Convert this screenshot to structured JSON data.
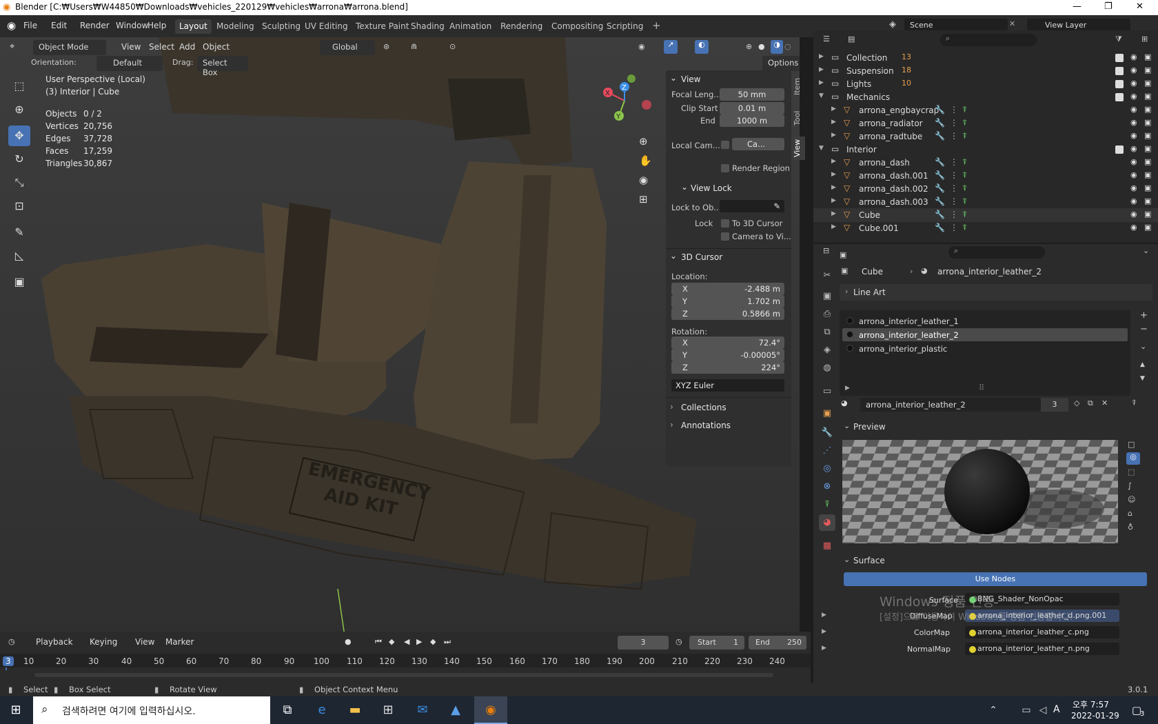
{
  "titlebar": {
    "title": "Blender [C:₩Users₩W44850₩Downloads₩vehicles_220129₩vehicles₩arrona₩arrona.blend]",
    "minimize": "—",
    "maximize": "❐",
    "close": "✕"
  },
  "menus": [
    "File",
    "Edit",
    "Render",
    "Window",
    "Help"
  ],
  "workspaces": [
    "Layout",
    "Modeling",
    "Sculpting",
    "UV Editing",
    "Texture Paint",
    "Shading",
    "Animation",
    "Rendering",
    "Compositing",
    "Scripting"
  ],
  "active_workspace": "Layout",
  "scene": {
    "label": "Scene",
    "view_layer": "View Layer"
  },
  "viewport_header": {
    "mode": "Object Mode",
    "menus": [
      "View",
      "Select",
      "Add",
      "Object"
    ],
    "transform": "Global",
    "options": "Options"
  },
  "tool_settings": {
    "orientation_label": "Orientation:",
    "orientation_value": "Default",
    "drag_label": "Drag:",
    "drag_value": "Select Box"
  },
  "viewport_info": {
    "view_name": "User Perspective (Local)",
    "context": "(3) Interior | Cube"
  },
  "stats": [
    {
      "label": "Objects",
      "value": "0 / 2"
    },
    {
      "label": "Vertices",
      "value": "20,756"
    },
    {
      "label": "Edges",
      "value": "37,728"
    },
    {
      "label": "Faces",
      "value": "17,259"
    },
    {
      "label": "Triangles",
      "value": "30,867"
    }
  ],
  "scene_label": {
    "line1": "EMERGENCY",
    "line2": "AID KIT"
  },
  "npanel": {
    "view_title": "View",
    "focal_label": "Focal Leng...",
    "focal_value": "50 mm",
    "clip_start_label": "Clip Start",
    "clip_start_value": "0.01 m",
    "clip_end_label": "End",
    "clip_end_value": "1000 m",
    "local_cam_label": "Local Cam...",
    "local_cam_value": "Ca...",
    "render_region": "Render Region",
    "view_lock_title": "View Lock",
    "lock_to_obj_label": "Lock to Ob...",
    "lock_label": "Lock",
    "to_3d_cursor": "To 3D Cursor",
    "camera_to_view": "Camera to Vi...",
    "cursor_title": "3D Cursor",
    "location_label": "Location:",
    "loc": [
      {
        "axis": "X",
        "value": "-2.488 m"
      },
      {
        "axis": "Y",
        "value": "1.702 m"
      },
      {
        "axis": "Z",
        "value": "0.5866 m"
      }
    ],
    "rotation_label": "Rotation:",
    "rot": [
      {
        "axis": "X",
        "value": "72.4°"
      },
      {
        "axis": "Y",
        "value": "-0.00005°"
      },
      {
        "axis": "Z",
        "value": "224°"
      }
    ],
    "rotation_mode": "XYZ Euler",
    "collections": "Collections",
    "annotations": "Annotations",
    "tabs": [
      "Item",
      "Tool",
      "View"
    ]
  },
  "outliner": [
    {
      "name": "Collection",
      "type": "collection",
      "badge": "13"
    },
    {
      "name": "Suspension",
      "type": "collection",
      "badge": "18"
    },
    {
      "name": "Lights",
      "type": "collection",
      "badge": "10"
    },
    {
      "name": "Mechanics",
      "type": "collection",
      "badge": ""
    },
    {
      "name": "arrona_engbaycrap",
      "type": "object",
      "badge": ""
    },
    {
      "name": "arrona_radiator",
      "type": "object",
      "badge": ""
    },
    {
      "name": "arrona_radtube",
      "type": "object",
      "badge": ""
    },
    {
      "name": "Interior",
      "type": "collection",
      "badge": ""
    },
    {
      "name": "arrona_dash",
      "type": "object",
      "badge": ""
    },
    {
      "name": "arrona_dash.001",
      "type": "object",
      "badge": ""
    },
    {
      "name": "arrona_dash.002",
      "type": "object",
      "badge": ""
    },
    {
      "name": "arrona_dash.003",
      "type": "object",
      "badge": ""
    },
    {
      "name": "Cube",
      "type": "object",
      "badge": ""
    },
    {
      "name": "Cube.001",
      "type": "object",
      "badge": ""
    }
  ],
  "properties": {
    "breadcrumb_obj": "Cube",
    "breadcrumb_mat": "arrona_interior_leather_2",
    "line_art": "Line Art",
    "slots": [
      "arrona_interior_leather_1",
      "arrona_interior_leather_2",
      "arrona_interior_plastic"
    ],
    "selected_slot": 1,
    "material_name": "arrona_interior_leather_2",
    "user_count": "3",
    "preview": "Preview",
    "surface_title": "Surface",
    "use_nodes": "Use Nodes",
    "surface_label": "Surface",
    "surface_value": "BNG_Shader_NonOpac",
    "maps": [
      {
        "label": "DiffuseMap",
        "value": "arrona_interior_leather_d.png.001"
      },
      {
        "label": "ColorMap",
        "value": "arrona_interior_leather_c.png"
      },
      {
        "label": "NormalMap",
        "value": "arrona_interior_leather_n.png"
      }
    ]
  },
  "watermark": {
    "line1": "Windows 정품 인증",
    "line2": "[설정]으로 이동하여 Windows를 정품 인증합니다."
  },
  "timeline": {
    "menus": [
      "Playback",
      "Keying",
      "View",
      "Marker"
    ],
    "current_frame": "3",
    "start_label": "Start",
    "start": "1",
    "end_label": "End",
    "end": "250",
    "ticks": [
      "3",
      "10",
      "20",
      "30",
      "40",
      "50",
      "60",
      "70",
      "80",
      "90",
      "100",
      "110",
      "120",
      "130",
      "140",
      "150",
      "160",
      "170",
      "180",
      "190",
      "200",
      "210",
      "220",
      "230",
      "240"
    ]
  },
  "statusbar": {
    "select": "Select",
    "box_select": "Box Select",
    "rotate_view": "Rotate View",
    "context_menu": "Object Context Menu",
    "version": "3.0.1"
  },
  "taskbar": {
    "search_placeholder": "검색하려면 여기에 입력하십시오.",
    "time": "오후 7:57",
    "date": "2022-01-29",
    "lang": "A",
    "notif": "3"
  }
}
